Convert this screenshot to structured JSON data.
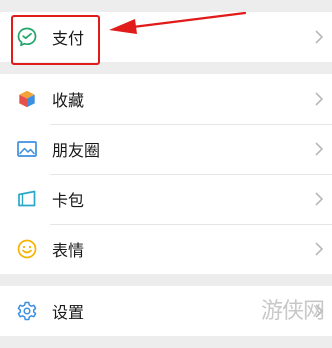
{
  "menu": {
    "pay_label": "支付",
    "favorites_label": "收藏",
    "moments_label": "朋友圈",
    "cards_label": "卡包",
    "stickers_label": "表情",
    "settings_label": "设置"
  },
  "icons": {
    "pay": "wechat-pay-icon",
    "favorites": "cube-icon",
    "moments": "photo-icon",
    "cards": "card-icon",
    "stickers": "smiley-icon",
    "settings": "gear-icon",
    "chevron": "chevron-right-icon"
  },
  "annotation": {
    "highlight_color": "#e11a1a"
  },
  "watermark": {
    "text": "游侠网"
  }
}
